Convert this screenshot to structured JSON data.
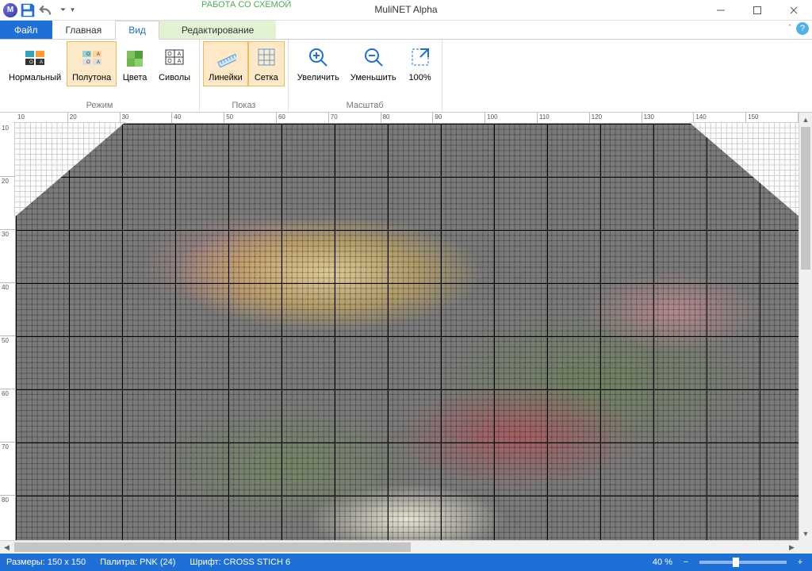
{
  "app": {
    "title": "MuliNET Alpha"
  },
  "contextual": {
    "title": "РАБОТА СО СХЕМОЙ",
    "tab": "Редактирование"
  },
  "tabs": {
    "file": "Файл",
    "home": "Главная",
    "view": "Вид"
  },
  "ribbon": {
    "mode": {
      "label": "Режим",
      "normal": "Нормальный",
      "halftone": "Полутона",
      "colors": "Цвета",
      "symbols": "Сиволы"
    },
    "show": {
      "label": "Показ",
      "rulers": "Линейки",
      "grid": "Сетка"
    },
    "zoom": {
      "label": "Масштаб",
      "zoomin": "Увеличить",
      "zoomout": "Уменьшить",
      "z100": "100%"
    }
  },
  "ruler_top": [
    "10",
    "20",
    "30",
    "40",
    "50",
    "60",
    "70",
    "80",
    "90",
    "100",
    "110",
    "120",
    "130",
    "140",
    "150"
  ],
  "ruler_left": [
    "10",
    "20",
    "30",
    "40",
    "50",
    "60",
    "70",
    "80"
  ],
  "status": {
    "dimensions_label": "Размеры:",
    "dimensions": "150 x 150",
    "palette_label": "Палитра:",
    "palette": "PNK (24)",
    "font_label": "Шрифт:",
    "font": "CROSS STICH 6",
    "zoom": "40 %"
  }
}
